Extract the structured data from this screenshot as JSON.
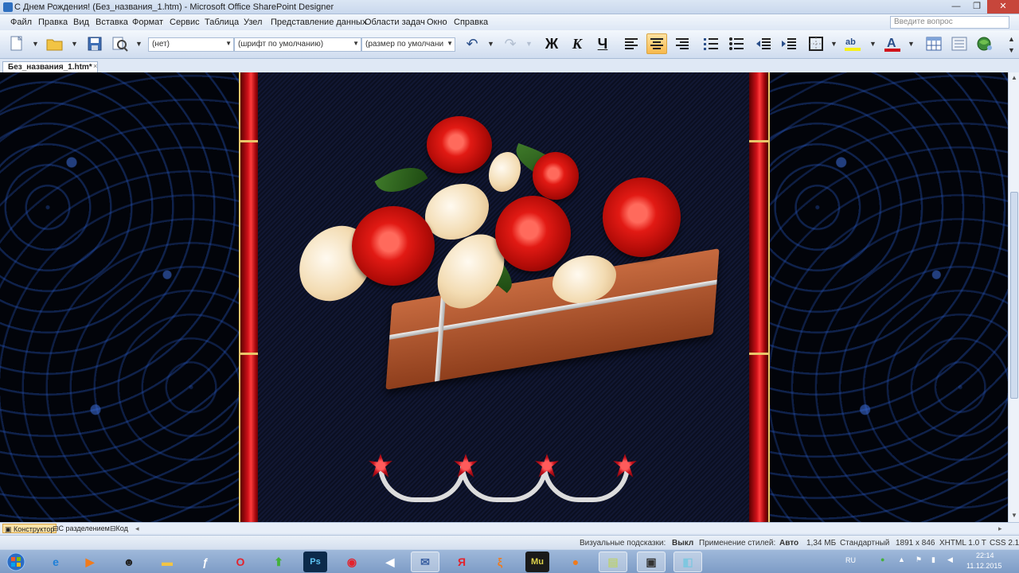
{
  "window": {
    "title": "С Днем Рождения! (Без_названия_1.htm) - Microsoft Office SharePoint Designer",
    "minimize": "—",
    "maximize": "❐",
    "close": "✕"
  },
  "menu": {
    "items": [
      "Файл",
      "Правка",
      "Вид",
      "Вставка",
      "Формат",
      "Сервис",
      "Таблица",
      "Узел",
      "Представление данных",
      "Области задач",
      "Окно",
      "Справка"
    ],
    "ask_placeholder": "Введите вопрос"
  },
  "toolbar": {
    "style_combo": "(нет)",
    "font_combo": "(шрифт по умолчанию)",
    "size_combo": "(размер по умолчани",
    "bold": "Ж",
    "italic": "К",
    "underline": "Ч"
  },
  "document": {
    "tab_label": "Без_названия_1.htm*",
    "tab_close": "×"
  },
  "views": {
    "design": "Конструктор",
    "split": "С разделением",
    "code": "Код"
  },
  "status": {
    "visual_aids_label": "Визуальные подсказки:",
    "visual_aids_value": "Выкл",
    "style_apply_label": "Применение стилей:",
    "style_apply_value": "Авто",
    "file_size": "1,34 МБ",
    "mode": "Стандартный",
    "dimensions": "1891 x 846",
    "doctype": "XHTML 1.0 T",
    "css": "CSS 2.1"
  },
  "taskbar": {
    "lang": "RU",
    "time": "22:14",
    "date": "11.12.2015",
    "apps": [
      "start-orb",
      "internet-explorer",
      "media-player",
      "game-app",
      "file-explorer",
      "flash",
      "opera",
      "green-arrow-app",
      "photoshop",
      "chrome",
      "audio-app",
      "mail-app",
      "yandex",
      "lizard-app",
      "muse",
      "firefox",
      "notebook-app",
      "video-app",
      "sharepoint-designer"
    ],
    "labels": {
      "photoshop": "Ps",
      "muse": "Mu",
      "yandex": "Я"
    }
  },
  "colors": {
    "accent": "#2e6fbf",
    "active_tool": "#f8b94c",
    "ribbon_red": "#d0121a",
    "gold": "#e9c66a"
  }
}
